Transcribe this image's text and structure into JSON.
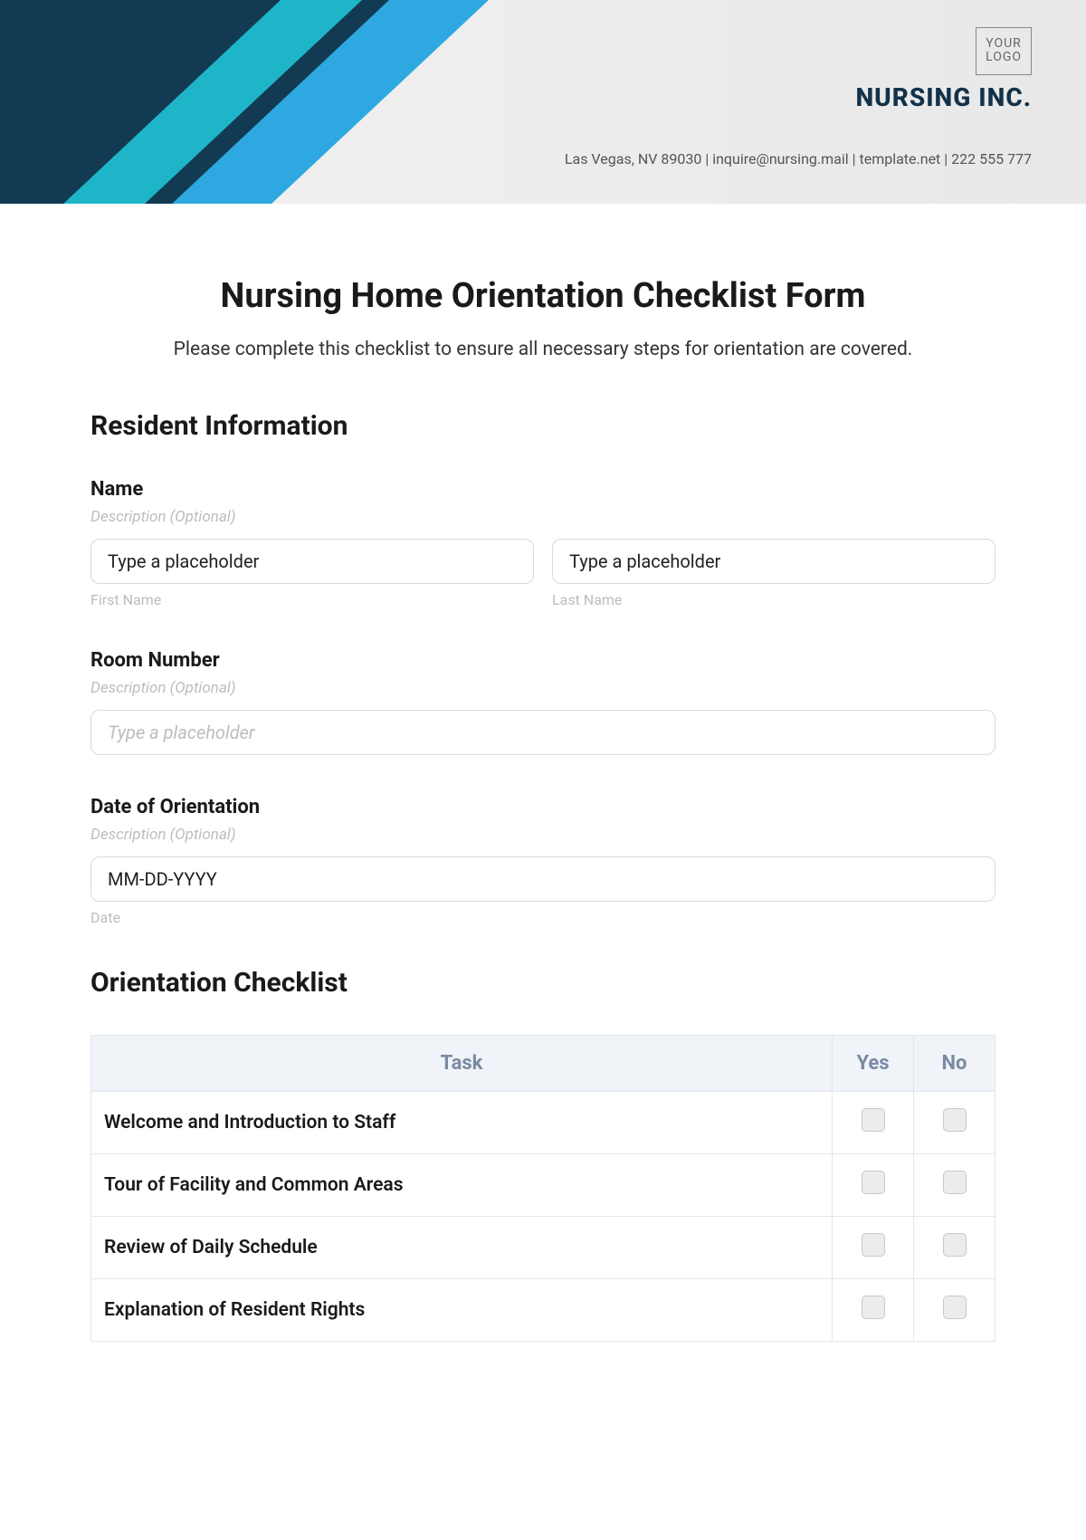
{
  "header": {
    "logo_text_1": "YOUR",
    "logo_text_2": "LOGO",
    "company": "NURSING INC.",
    "contact": "Las Vegas, NV 89030 | inquire@nursing.mail | template.net | 222 555 777"
  },
  "title": "Nursing Home Orientation Checklist Form",
  "subtitle": "Please complete this checklist to ensure all necessary steps for orientation are covered.",
  "sections": {
    "resident_info": "Resident Information",
    "checklist": "Orientation Checklist"
  },
  "fields": {
    "name": {
      "label": "Name",
      "desc": "Description (Optional)",
      "first_placeholder": "Type a placeholder",
      "last_placeholder": "Type a placeholder",
      "first_sub": "First Name",
      "last_sub": "Last Name"
    },
    "room": {
      "label": "Room Number",
      "desc": "Description (Optional)",
      "placeholder": "Type a placeholder"
    },
    "date": {
      "label": "Date of Orientation",
      "desc": "Description (Optional)",
      "placeholder": "MM-DD-YYYY",
      "sub": "Date"
    }
  },
  "table": {
    "headers": {
      "task": "Task",
      "yes": "Yes",
      "no": "No"
    },
    "rows": [
      "Welcome and Introduction to Staff",
      "Tour of Facility and Common Areas",
      "Review of Daily Schedule",
      "Explanation of Resident Rights"
    ]
  }
}
